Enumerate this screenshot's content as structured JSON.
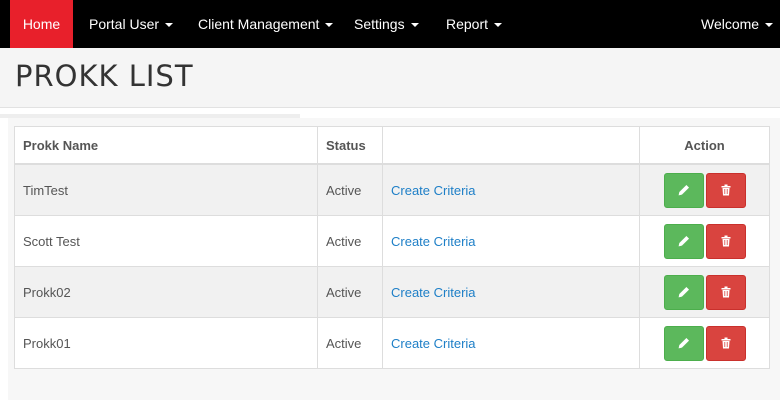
{
  "navbar": {
    "items": [
      {
        "label": "Home",
        "active": true,
        "caret": false
      },
      {
        "label": "Portal User",
        "active": false,
        "caret": true
      },
      {
        "label": "Client Management",
        "active": false,
        "caret": true
      },
      {
        "label": "Settings",
        "active": false,
        "caret": true
      },
      {
        "label": "Report",
        "active": false,
        "caret": true
      }
    ],
    "welcome": {
      "label": "Welcome",
      "caret": true
    }
  },
  "page": {
    "title": "PROKK LIST"
  },
  "table": {
    "columns": [
      "Prokk Name",
      "Status",
      "",
      "Action"
    ],
    "rows": [
      {
        "name": "TimTest",
        "status": "Active",
        "link": "Create Criteria"
      },
      {
        "name": "Scott Test",
        "status": "Active",
        "link": "Create Criteria"
      },
      {
        "name": "Prokk02",
        "status": "Active",
        "link": "Create Criteria"
      },
      {
        "name": "Prokk01",
        "status": "Active",
        "link": "Create Criteria"
      }
    ]
  },
  "icons": {
    "edit": "pencil-icon",
    "delete": "trash-icon"
  },
  "colors": {
    "navbar_bg": "#000000",
    "active_nav": "#e8202b",
    "link": "#1e7fc7",
    "edit_button": "#5cb85c",
    "delete_button": "#d9443f"
  }
}
